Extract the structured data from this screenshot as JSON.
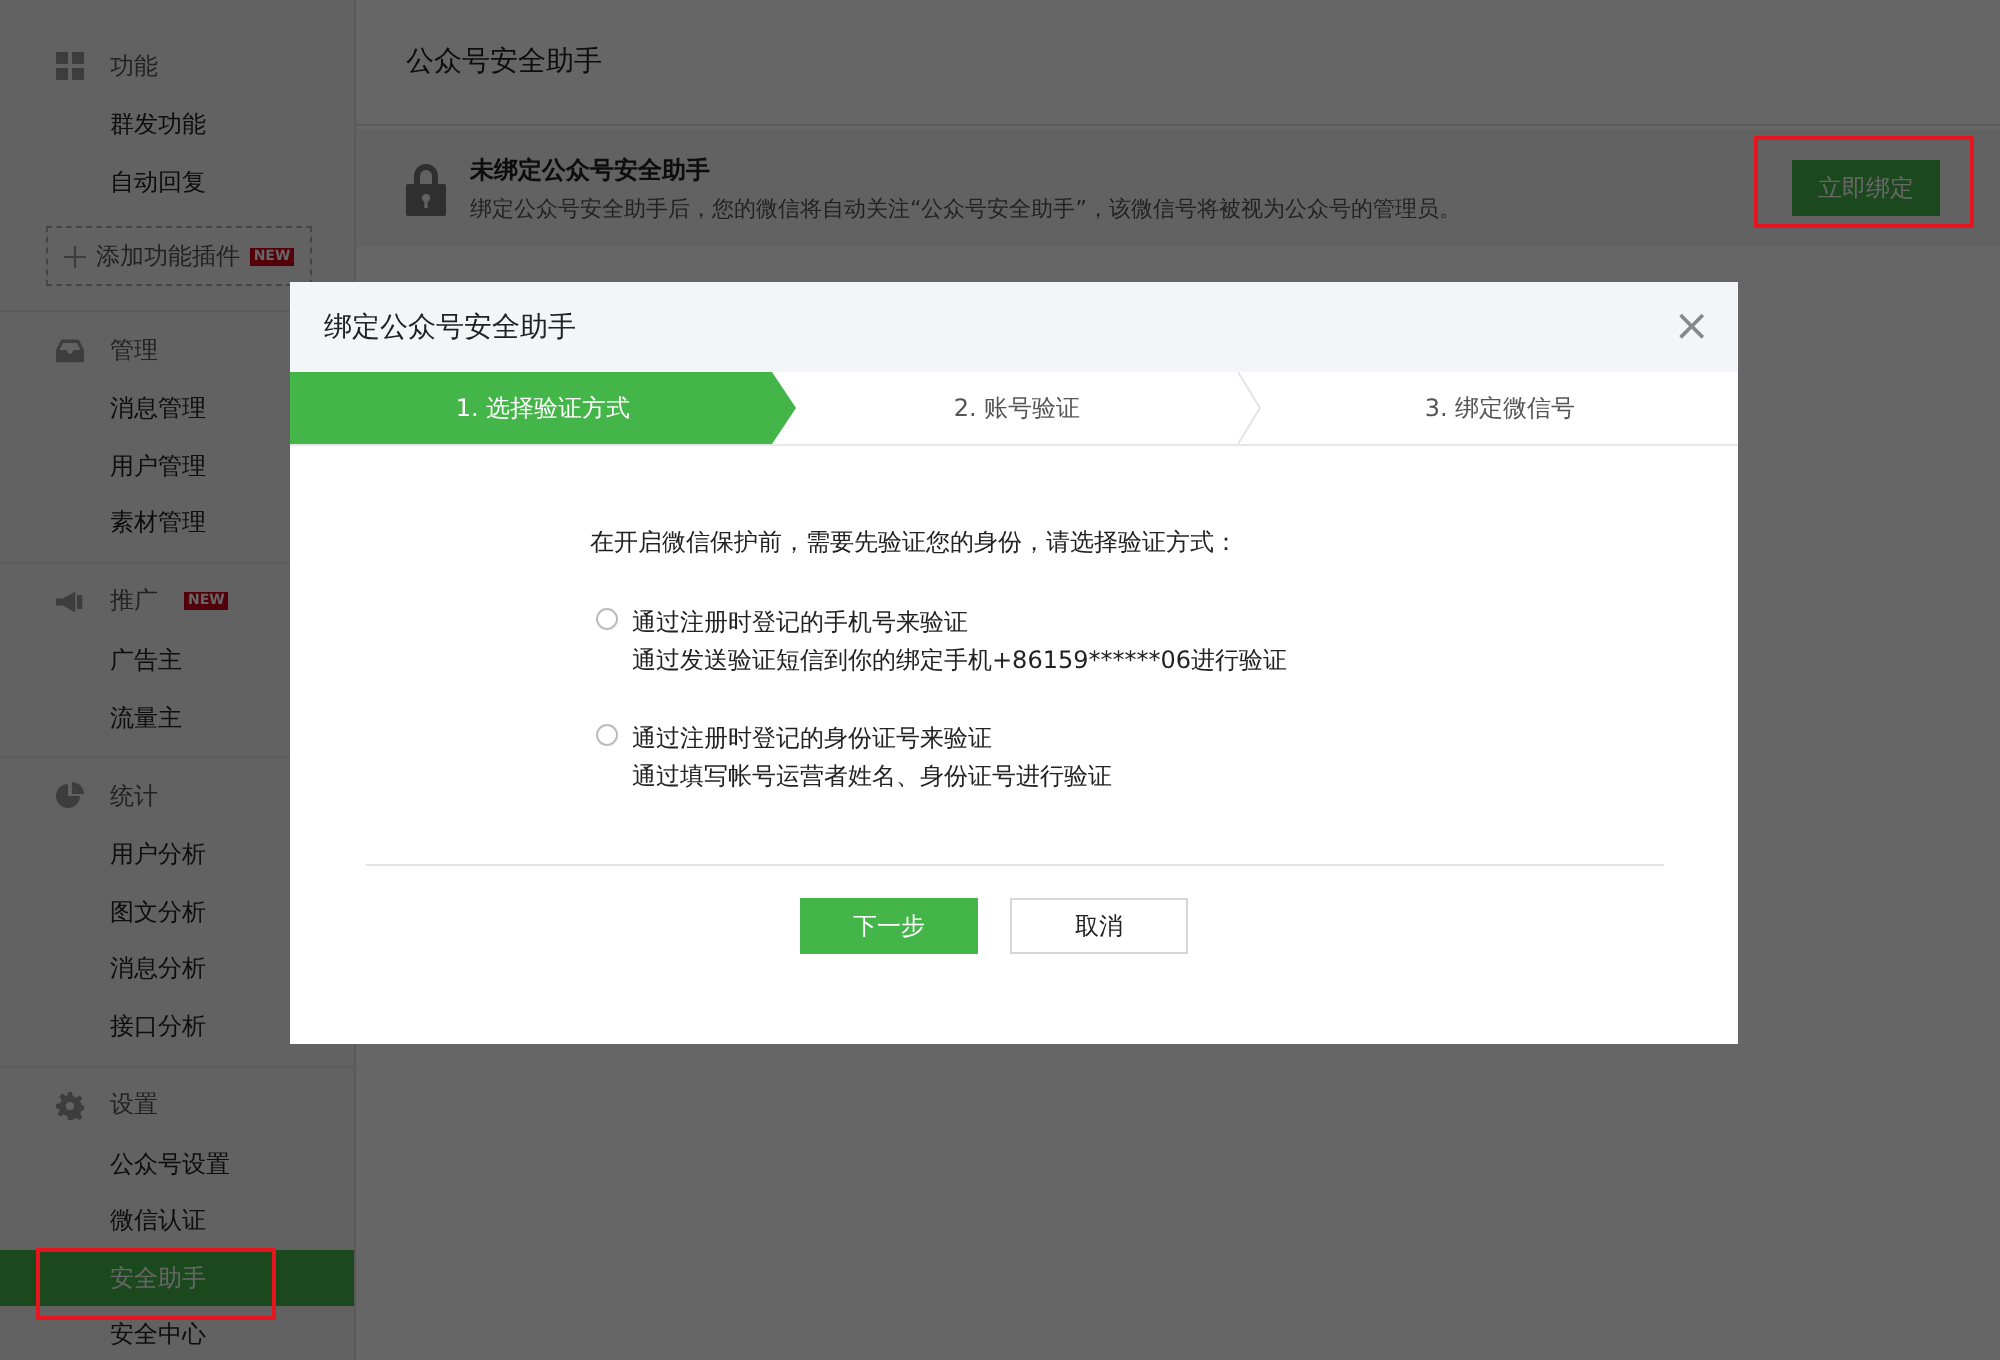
{
  "sidebar": {
    "sections": [
      {
        "title": "功能",
        "items": [
          {
            "label": "群发功能",
            "selected": false
          },
          {
            "label": "自动回复",
            "selected": false
          }
        ],
        "action": {
          "label": "添加功能插件",
          "badge": "NEW"
        }
      },
      {
        "title": "管理",
        "items": [
          {
            "label": "消息管理",
            "selected": false
          },
          {
            "label": "用户管理",
            "selected": false
          },
          {
            "label": "素材管理",
            "selected": false
          }
        ]
      },
      {
        "title": "推广",
        "badge": "NEW",
        "items": [
          {
            "label": "广告主",
            "selected": false
          },
          {
            "label": "流量主",
            "selected": false
          }
        ]
      },
      {
        "title": "统计",
        "items": [
          {
            "label": "用户分析",
            "selected": false
          },
          {
            "label": "图文分析",
            "selected": false
          },
          {
            "label": "消息分析",
            "selected": false
          },
          {
            "label": "接口分析",
            "selected": false
          }
        ]
      },
      {
        "title": "设置",
        "items": [
          {
            "label": "公众号设置",
            "selected": false
          },
          {
            "label": "微信认证",
            "selected": false
          },
          {
            "label": "安全助手",
            "selected": true
          },
          {
            "label": "安全中心",
            "selected": false
          }
        ]
      }
    ]
  },
  "page": {
    "title": "公众号安全助手",
    "notice": {
      "title": "未绑定公众号安全助手",
      "description": "绑定公众号安全助手后，您的微信将自动关注“公众号安全助手”，该微信号将被视为公众号的管理员。",
      "button": "立即绑定"
    }
  },
  "dialog": {
    "title": "绑定公众号安全助手",
    "close": "×",
    "steps": [
      {
        "label": "1. 选择验证方式",
        "selected": true
      },
      {
        "label": "2. 账号验证",
        "selected": false
      },
      {
        "label": "3. 绑定微信号",
        "selected": false
      }
    ],
    "prompt": "在开启微信保护前，需要先验证您的身份，请选择验证方式：",
    "options": [
      {
        "label": "通过注册时登记的手机号来验证",
        "description": "通过发送验证短信到你的绑定手机+86159******06进行验证",
        "selected": false
      },
      {
        "label": "通过注册时登记的身份证号来验证",
        "description": "通过填写帐号运营者姓名、身份证号进行验证",
        "selected": false
      }
    ],
    "buttons": [
      {
        "label": "下一步",
        "kind": "primary"
      },
      {
        "label": "取消",
        "kind": "secondary"
      }
    ]
  }
}
